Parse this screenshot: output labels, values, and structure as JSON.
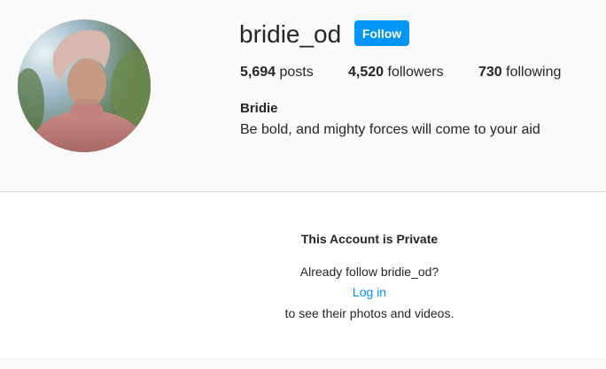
{
  "profile": {
    "username": "bridie_od",
    "follow_label": "Follow",
    "full_name": "Bridie",
    "bio": "Be bold, and mighty forces will come to your aid",
    "stats": {
      "posts_count": "5,694",
      "posts_label": " posts",
      "followers_count": "4,520",
      "followers_label": " followers",
      "following_count": "730",
      "following_label": " following"
    }
  },
  "private_notice": {
    "title": "This Account is Private",
    "already_follow": "Already follow bridie_od?",
    "login_link": "Log in",
    "see_photos": "to see their photos and videos."
  },
  "colors": {
    "accent": "#0095f6",
    "text": "#262626",
    "background": "#fafafa",
    "divider": "#dbdbdb"
  }
}
